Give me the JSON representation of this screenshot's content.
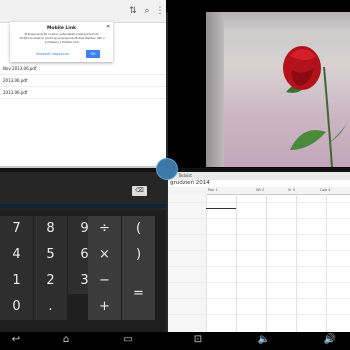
{
  "document_app": {
    "toolbar": {
      "sort_icon": "sort-icon",
      "search_icon": "search-icon",
      "menu_icon": "more-vert-icon"
    },
    "dialog": {
      "title": "Mobile Link",
      "body": "Pripojenie pribi ocamo extendkati zrezidyimomot, utrdjbomumet si prohrog propojenie Mobile Nastav Vall o prihlasen s Mobile Link",
      "link_label": "Zobraziť nápovedu",
      "button_label": "OK"
    },
    "files": [
      "Nov 2013.06.pdf",
      "2013.06.pdf",
      "2013.06.pdf"
    ]
  },
  "calculator": {
    "delete_label": "⌫",
    "keys": [
      "7",
      "8",
      "9",
      "÷",
      "(",
      "4",
      "5",
      "6",
      "×",
      ")",
      "1",
      "2",
      "3",
      "−",
      "0",
      ".",
      "+",
      "="
    ]
  },
  "calendar": {
    "window_title": "Todoist",
    "month_title": "grudzień 2014",
    "columns": [
      "Pon 1",
      "Wt 2",
      "Śr 3",
      "Czw 4"
    ]
  },
  "navbar": {
    "back_icon": "back-icon",
    "home_icon": "home-icon",
    "recents_icon": "recents-icon",
    "screenshot_icon": "screenshot-icon",
    "volume_down_icon": "volume-down-icon",
    "volume_up_icon": "volume-up-icon"
  }
}
